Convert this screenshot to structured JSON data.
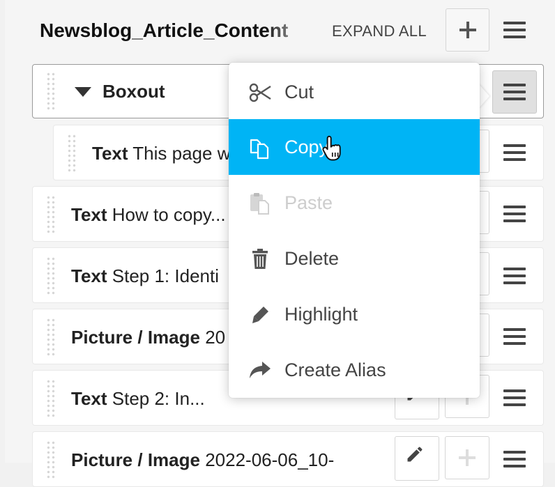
{
  "header": {
    "title": "Newsblog_Article_Content",
    "expand_all": "EXPAND ALL"
  },
  "rows": [
    {
      "type": "Boxout",
      "text": ""
    },
    {
      "type": "Text",
      "text": "This page w"
    },
    {
      "type": "Text",
      "text": "How to copy..."
    },
    {
      "type": "Text",
      "text": "Step 1: Identi"
    },
    {
      "type": "Picture / Image",
      "text": "20"
    },
    {
      "type": "Text",
      "text": "Step 2: In..."
    },
    {
      "type": "Picture / Image",
      "text": "2022-06-06_10-"
    }
  ],
  "context_menu": {
    "items": [
      {
        "label": "Cut",
        "icon": "scissors-icon",
        "state": "normal"
      },
      {
        "label": "Copy",
        "icon": "copy-icon",
        "state": "hover"
      },
      {
        "label": "Paste",
        "icon": "paste-icon",
        "state": "disabled"
      },
      {
        "label": "Delete",
        "icon": "trash-icon",
        "state": "normal"
      },
      {
        "label": "Highlight",
        "icon": "pencil-icon",
        "state": "normal"
      },
      {
        "label": "Create Alias",
        "icon": "share-arrow-icon",
        "state": "normal"
      }
    ]
  },
  "colors": {
    "accent": "#00b4f5",
    "panel_bg": "#f5f5f5",
    "row_bg": "#ffffff"
  }
}
